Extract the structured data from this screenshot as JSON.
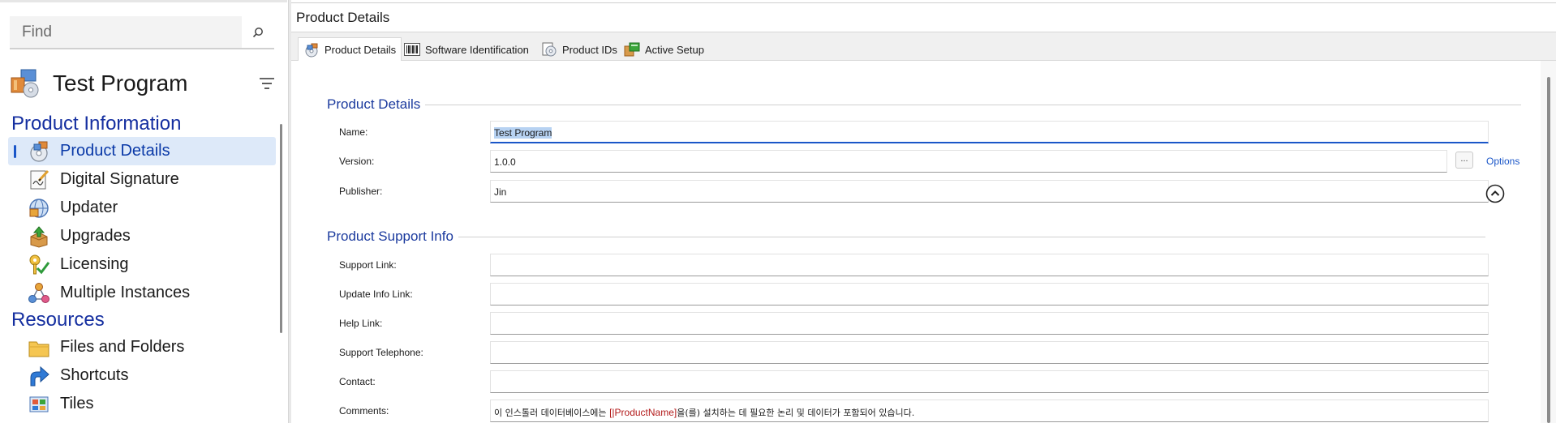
{
  "sidebar": {
    "find_placeholder": "Find",
    "project_name": "Test Program",
    "groups": [
      {
        "label": "Product Information",
        "items": [
          {
            "label": "Product Details",
            "icon": "product-details-icon",
            "selected": true
          },
          {
            "label": "Digital Signature",
            "icon": "digital-signature-icon"
          },
          {
            "label": "Updater",
            "icon": "updater-icon"
          },
          {
            "label": "Upgrades",
            "icon": "upgrades-icon"
          },
          {
            "label": "Licensing",
            "icon": "licensing-icon"
          },
          {
            "label": "Multiple Instances",
            "icon": "multiple-instances-icon"
          }
        ]
      },
      {
        "label": "Resources",
        "items": [
          {
            "label": "Files and Folders",
            "icon": "folder-icon"
          },
          {
            "label": "Shortcuts",
            "icon": "shortcut-icon"
          },
          {
            "label": "Tiles",
            "icon": "tiles-icon"
          }
        ]
      }
    ]
  },
  "main": {
    "title": "Product Details",
    "tabs": [
      {
        "label": "Product Details",
        "icon": "product-details-icon",
        "active": true
      },
      {
        "label": "Software Identification",
        "icon": "barcode-icon"
      },
      {
        "label": "Product IDs",
        "icon": "product-ids-icon"
      },
      {
        "label": "Active Setup",
        "icon": "active-setup-icon"
      }
    ],
    "product_details": {
      "section_title": "Product Details",
      "name_label": "Name:",
      "name_value": "Test Program",
      "version_label": "Version:",
      "version_value": "1.0.0",
      "version_browse": "...",
      "options_link": "Options",
      "publisher_label": "Publisher:",
      "publisher_value": "Jin"
    },
    "support_info": {
      "section_title": "Product Support Info",
      "support_link_label": "Support Link:",
      "support_link_value": "",
      "update_info_link_label": "Update Info Link:",
      "update_info_link_value": "",
      "help_link_label": "Help Link:",
      "help_link_value": "",
      "support_telephone_label": "Support Telephone:",
      "support_telephone_value": "",
      "contact_label": "Contact:",
      "contact_value": "",
      "comments_label": "Comments:",
      "comments_prefix": "이 인스톨러 데이터베이스에는 ",
      "comments_property": "[|ProductName]",
      "comments_suffix": "을(를) 설치하는 데 필요한 논리 및 데이터가 포함되어 있습니다."
    }
  },
  "colors": {
    "accent": "#1a56c8",
    "group_heading": "#152fa0",
    "selected_bg": "#dde9f9",
    "property_red": "#b31b1b"
  }
}
